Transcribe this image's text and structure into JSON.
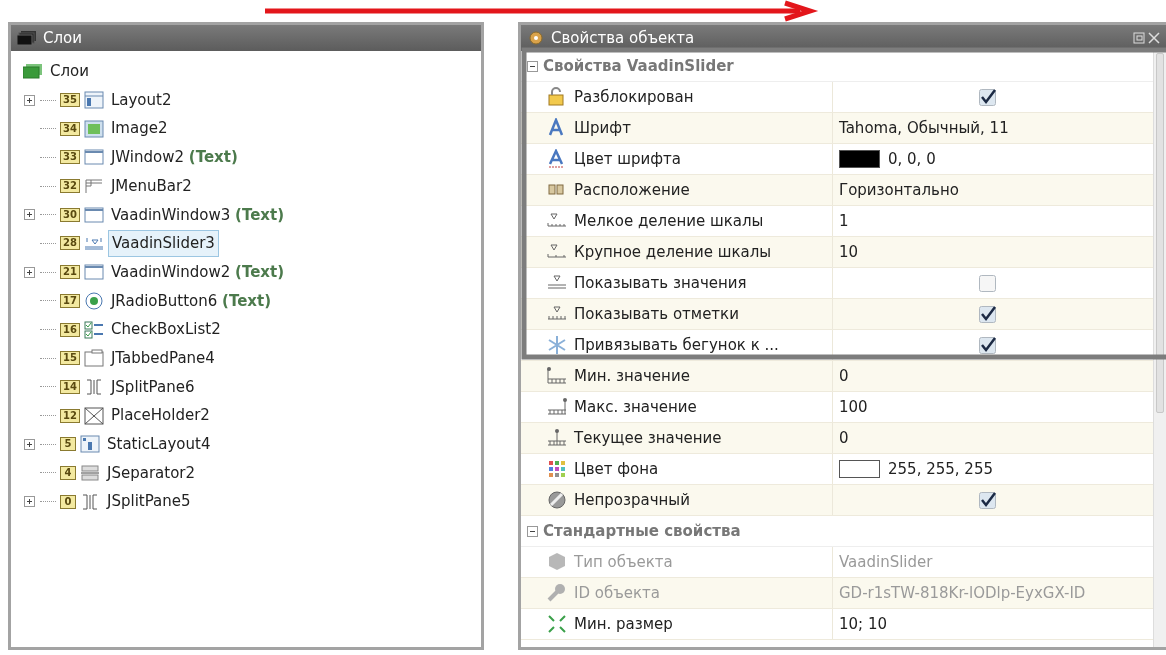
{
  "layers_panel": {
    "title": "Слои",
    "tree": {
      "label": "Слои",
      "children": [
        {
          "badge": "35",
          "label": "Layout2",
          "expandable": true,
          "selected": false
        },
        {
          "badge": "34",
          "label": "Image2",
          "expandable": false,
          "selected": false
        },
        {
          "badge": "33",
          "label": "JWindow2",
          "tag": "(Text)",
          "expandable": false,
          "selected": false
        },
        {
          "badge": "32",
          "label": "JMenuBar2",
          "expandable": false,
          "selected": false
        },
        {
          "badge": "30",
          "label": "VaadinWindow3",
          "tag": "(Text)",
          "expandable": true,
          "selected": false
        },
        {
          "badge": "28",
          "label": "VaadinSlider3",
          "expandable": false,
          "selected": true
        },
        {
          "badge": "21",
          "label": "VaadinWindow2",
          "tag": "(Text)",
          "expandable": true,
          "selected": false
        },
        {
          "badge": "17",
          "label": "JRadioButton6",
          "tag": "(Text)",
          "expandable": false,
          "selected": false
        },
        {
          "badge": "16",
          "label": "CheckBoxList2",
          "expandable": false,
          "selected": false
        },
        {
          "badge": "15",
          "label": "JTabbedPane4",
          "expandable": false,
          "selected": false
        },
        {
          "badge": "14",
          "label": "JSplitPane6",
          "expandable": false,
          "selected": false
        },
        {
          "badge": "12",
          "label": "PlaceHolder2",
          "expandable": false,
          "selected": false
        },
        {
          "badge": "5",
          "label": "StaticLayout4",
          "expandable": true,
          "selected": false
        },
        {
          "badge": "4",
          "label": "JSeparator2",
          "expandable": false,
          "selected": false
        },
        {
          "badge": "0",
          "label": "JSplitPane5",
          "expandable": true,
          "selected": false
        }
      ]
    }
  },
  "properties_panel": {
    "title": "Свойства объекта",
    "groups": [
      {
        "title": "Свойства VaadinSlider",
        "expanded": true,
        "rows": [
          {
            "kind": "check",
            "name": "Разблокирован",
            "checked": true,
            "disabled": false
          },
          {
            "kind": "text",
            "name": "Шрифт",
            "value": "Tahoma, Обычный, 11",
            "disabled": false
          },
          {
            "kind": "color",
            "name": "Цвет шрифта",
            "color": "#000000",
            "value": "0, 0, 0",
            "disabled": false
          },
          {
            "kind": "text",
            "name": "Расположение",
            "value": "Горизонтально",
            "disabled": false
          },
          {
            "kind": "text",
            "name": "Мелкое деление шкалы",
            "value": "1",
            "disabled": false
          },
          {
            "kind": "text",
            "name": "Крупное деление шкалы",
            "value": "10",
            "disabled": false
          },
          {
            "kind": "check",
            "name": "Показывать значения",
            "checked": false,
            "disabled": false
          },
          {
            "kind": "check",
            "name": "Показывать отметки",
            "checked": true,
            "disabled": false
          },
          {
            "kind": "check",
            "name": "Привязывать бегунок к ...",
            "checked": true,
            "disabled": false
          },
          {
            "kind": "text",
            "name": "Мин. значение",
            "value": "0",
            "disabled": false
          },
          {
            "kind": "text",
            "name": "Макс. значение",
            "value": "100",
            "disabled": false
          },
          {
            "kind": "text",
            "name": "Текущее значение",
            "value": "0",
            "disabled": false
          },
          {
            "kind": "color",
            "name": "Цвет фона",
            "color": "#ffffff",
            "value": "255, 255, 255",
            "disabled": false
          },
          {
            "kind": "check",
            "name": "Непрозрачный",
            "checked": true,
            "disabled": false
          }
        ]
      },
      {
        "title": "Стандартные свойства",
        "expanded": true,
        "rows": [
          {
            "kind": "text",
            "name": "Тип объекта",
            "value": "VaadinSlider",
            "disabled": true
          },
          {
            "kind": "text",
            "name": "ID объекта",
            "value": "GD-r1sTW-818Kr-lODlp-EyxGX-ID",
            "disabled": true
          },
          {
            "kind": "text",
            "name": "Мин. размер",
            "value": "10; 10",
            "disabled": false
          }
        ]
      }
    ]
  }
}
